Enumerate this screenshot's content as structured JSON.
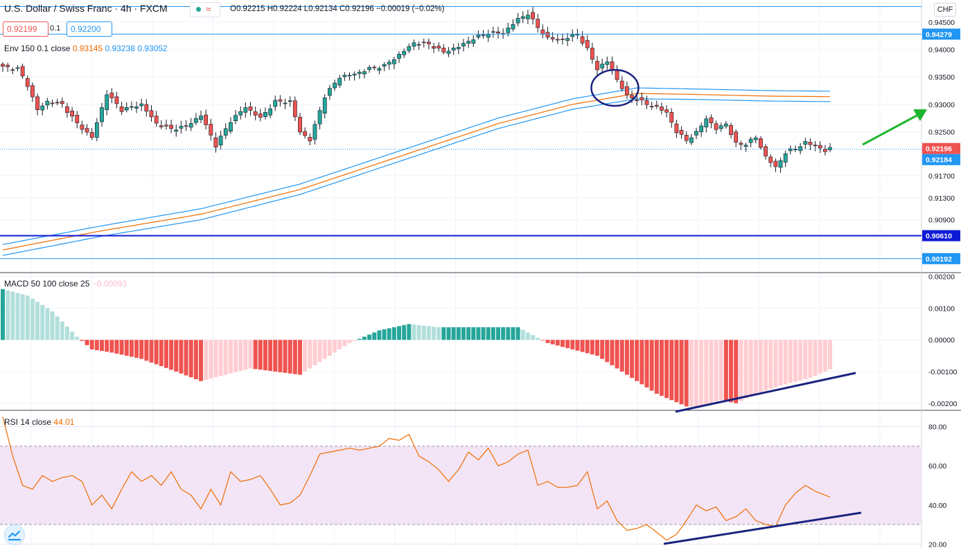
{
  "header": {
    "title": "U.S. Dollar / Swiss Franc · 4h · FXCM",
    "ohlc": "O0.92215  H0.92224  L0.92134  C0.92196  −0.00019 (−0.02%)",
    "bid": "0.92199",
    "spread": "0.1",
    "ask": "0.92200",
    "currency": "CHF"
  },
  "indicators": {
    "env_label": "Env 150 0.1 close",
    "env_v1": "0.93145",
    "env_v2": "0.93238",
    "env_v3": "0.93052",
    "macd_label": "MACD 50 100 close 25",
    "macd_value": "−0.00093",
    "rsi_label": "RSI 14 close",
    "rsi_value": "44.01"
  },
  "colors": {
    "up": "#26a69a",
    "down": "#ef5350",
    "env_mid": "#ef6c00",
    "env_band": "#2196f3",
    "rsi_line": "#ef6c00",
    "rsi_zone": "#f3e5f5",
    "hline_dark": "#0d1ad6",
    "hline_light": "#2196f3",
    "annotation": "#1a237e",
    "arrow": "#1cb52b",
    "macd_up_strong": "#26a69a",
    "macd_up_weak": "#b2dfdb",
    "macd_down_strong": "#ef5350",
    "macd_down_weak": "#ffcdd2"
  },
  "chart_data": [
    {
      "type": "candlestick",
      "panel": "price",
      "ylim": [
        0.8995,
        0.949
      ],
      "y_ticks": [
        "0.94500",
        "0.94000",
        "0.93500",
        "0.93000",
        "0.92500",
        "0.91700",
        "0.91300",
        "0.90900"
      ],
      "price_badges": [
        {
          "label": "0.94279",
          "price": 0.94279,
          "style": "light"
        },
        {
          "label": "0.92196",
          "price": 0.92196,
          "style": "current"
        },
        {
          "label": "0.92184",
          "price": 0.92184,
          "style": "light"
        },
        {
          "label": "0.90610",
          "price": 0.9061,
          "style": "dark"
        },
        {
          "label": "0.90192",
          "price": 0.90192,
          "style": "light"
        }
      ],
      "horizontal_lines": [
        {
          "price": 0.9478,
          "style": "light"
        },
        {
          "price": 0.94279,
          "style": "light"
        },
        {
          "price": 0.92184,
          "style": "dotted"
        },
        {
          "price": 0.9061,
          "style": "dark"
        },
        {
          "price": 0.90192,
          "style": "light"
        }
      ],
      "close_anchors": [
        [
          0,
          0.9368
        ],
        [
          3,
          0.9365
        ],
        [
          5,
          0.9335
        ],
        [
          7,
          0.929
        ],
        [
          9,
          0.9305
        ],
        [
          12,
          0.93
        ],
        [
          15,
          0.9265
        ],
        [
          18,
          0.924
        ],
        [
          21,
          0.932
        ],
        [
          24,
          0.929
        ],
        [
          28,
          0.93
        ],
        [
          31,
          0.9265
        ],
        [
          34,
          0.9255
        ],
        [
          37,
          0.926
        ],
        [
          40,
          0.928
        ],
        [
          43,
          0.9225
        ],
        [
          46,
          0.927
        ],
        [
          49,
          0.9295
        ],
        [
          52,
          0.9275
        ],
        [
          55,
          0.9305
        ],
        [
          58,
          0.9305
        ],
        [
          60,
          0.925
        ],
        [
          62,
          0.9235
        ],
        [
          65,
          0.9315
        ],
        [
          68,
          0.935
        ],
        [
          71,
          0.9355
        ],
        [
          74,
          0.9365
        ],
        [
          77,
          0.937
        ],
        [
          80,
          0.939
        ],
        [
          83,
          0.9412
        ],
        [
          86,
          0.941
        ],
        [
          89,
          0.9395
        ],
        [
          92,
          0.9405
        ],
        [
          95,
          0.942
        ],
        [
          98,
          0.943
        ],
        [
          101,
          0.943
        ],
        [
          104,
          0.9455
        ],
        [
          106,
          0.9465
        ],
        [
          108,
          0.944
        ],
        [
          110,
          0.942
        ],
        [
          113,
          0.9418
        ],
        [
          116,
          0.9428
        ],
        [
          118,
          0.94
        ],
        [
          120,
          0.9365
        ],
        [
          122,
          0.9378
        ],
        [
          124,
          0.9345
        ],
        [
          126,
          0.9315
        ],
        [
          128,
          0.931
        ],
        [
          130,
          0.93
        ],
        [
          132,
          0.9295
        ],
        [
          134,
          0.9285
        ],
        [
          136,
          0.925
        ],
        [
          138,
          0.9235
        ],
        [
          140,
          0.9248
        ],
        [
          142,
          0.9275
        ],
        [
          144,
          0.9255
        ],
        [
          146,
          0.9265
        ],
        [
          148,
          0.9228
        ],
        [
          150,
          0.9228
        ],
        [
          152,
          0.924
        ],
        [
          154,
          0.9205
        ],
        [
          156,
          0.9185
        ],
        [
          158,
          0.9212
        ],
        [
          160,
          0.922
        ],
        [
          162,
          0.923
        ],
        [
          164,
          0.9225
        ],
        [
          166,
          0.9215
        ],
        [
          167,
          0.92196
        ]
      ],
      "envelope": {
        "period": 150,
        "mid_points": [
          [
            0,
            0.9035
          ],
          [
            20,
            0.907
          ],
          [
            40,
            0.91
          ],
          [
            60,
            0.9145
          ],
          [
            80,
            0.9205
          ],
          [
            100,
            0.9265
          ],
          [
            115,
            0.93
          ],
          [
            128,
            0.932
          ],
          [
            140,
            0.9318
          ],
          [
            155,
            0.9315
          ],
          [
            167,
            0.9314
          ]
        ],
        "upper_points": [
          [
            0,
            0.9045
          ],
          [
            20,
            0.9079
          ],
          [
            40,
            0.911
          ],
          [
            60,
            0.9155
          ],
          [
            80,
            0.9215
          ],
          [
            100,
            0.9275
          ],
          [
            115,
            0.931
          ],
          [
            128,
            0.933
          ],
          [
            140,
            0.9328
          ],
          [
            155,
            0.9325
          ],
          [
            167,
            0.9324
          ]
        ],
        "lower_points": [
          [
            0,
            0.9025
          ],
          [
            20,
            0.906
          ],
          [
            40,
            0.909
          ],
          [
            60,
            0.9136
          ],
          [
            80,
            0.9196
          ],
          [
            100,
            0.9256
          ],
          [
            115,
            0.9291
          ],
          [
            128,
            0.931
          ],
          [
            140,
            0.9309
          ],
          [
            155,
            0.9306
          ],
          [
            167,
            0.9305
          ]
        ]
      }
    },
    {
      "type": "histogram",
      "panel": "macd",
      "ylim": [
        -0.0022,
        0.0021
      ],
      "y_ticks": [
        "0.00200",
        "0.00100",
        "0.00000",
        "-0.00100",
        "-0.00200"
      ],
      "anchors": [
        [
          0,
          0.0016
        ],
        [
          5,
          0.0014
        ],
        [
          10,
          0.0009
        ],
        [
          15,
          0.0001
        ],
        [
          18,
          -0.0003
        ],
        [
          22,
          -0.0004
        ],
        [
          28,
          -0.0006
        ],
        [
          35,
          -0.001
        ],
        [
          40,
          -0.0013
        ],
        [
          45,
          -0.0011
        ],
        [
          50,
          -0.0009
        ],
        [
          55,
          -0.001
        ],
        [
          60,
          -0.0011
        ],
        [
          65,
          -0.0006
        ],
        [
          70,
          -0.0001
        ],
        [
          76,
          0.0003
        ],
        [
          82,
          0.0005
        ],
        [
          88,
          0.0004
        ],
        [
          94,
          0.0004
        ],
        [
          100,
          0.0004
        ],
        [
          104,
          0.0004
        ],
        [
          110,
          -0.0001
        ],
        [
          115,
          -0.0003
        ],
        [
          120,
          -0.0005
        ],
        [
          126,
          -0.0011
        ],
        [
          132,
          -0.0017
        ],
        [
          138,
          -0.0021
        ],
        [
          141,
          -0.0021
        ],
        [
          145,
          -0.0019
        ],
        [
          148,
          -0.002
        ],
        [
          152,
          -0.0017
        ],
        [
          158,
          -0.0014
        ],
        [
          163,
          -0.0012
        ],
        [
          167,
          -0.00093
        ]
      ]
    },
    {
      "type": "line",
      "panel": "rsi",
      "ylim": [
        18,
        88
      ],
      "bands": [
        30,
        70
      ],
      "y_ticks": [
        "80.00",
        "60.00",
        "40.00",
        "20.00"
      ],
      "anchors": [
        [
          0,
          85
        ],
        [
          2,
          65
        ],
        [
          4,
          50
        ],
        [
          6,
          48
        ],
        [
          8,
          55
        ],
        [
          10,
          52
        ],
        [
          12,
          54
        ],
        [
          14,
          55
        ],
        [
          16,
          52
        ],
        [
          18,
          40
        ],
        [
          20,
          45
        ],
        [
          22,
          38
        ],
        [
          24,
          48
        ],
        [
          26,
          57
        ],
        [
          28,
          52
        ],
        [
          30,
          55
        ],
        [
          32,
          50
        ],
        [
          34,
          57
        ],
        [
          36,
          48
        ],
        [
          38,
          45
        ],
        [
          40,
          38
        ],
        [
          42,
          48
        ],
        [
          44,
          40
        ],
        [
          46,
          57
        ],
        [
          48,
          52
        ],
        [
          50,
          53
        ],
        [
          52,
          55
        ],
        [
          54,
          48
        ],
        [
          56,
          40
        ],
        [
          58,
          41
        ],
        [
          60,
          45
        ],
        [
          62,
          55
        ],
        [
          64,
          66
        ],
        [
          66,
          67
        ],
        [
          68,
          68
        ],
        [
          70,
          69
        ],
        [
          72,
          68
        ],
        [
          74,
          69
        ],
        [
          76,
          70
        ],
        [
          78,
          74
        ],
        [
          80,
          73
        ],
        [
          82,
          76
        ],
        [
          84,
          65
        ],
        [
          86,
          62
        ],
        [
          88,
          58
        ],
        [
          90,
          52
        ],
        [
          92,
          58
        ],
        [
          94,
          67
        ],
        [
          96,
          63
        ],
        [
          98,
          69
        ],
        [
          100,
          60
        ],
        [
          102,
          62
        ],
        [
          104,
          66
        ],
        [
          106,
          68
        ],
        [
          108,
          50
        ],
        [
          110,
          52
        ],
        [
          112,
          49
        ],
        [
          114,
          49
        ],
        [
          116,
          50
        ],
        [
          118,
          57
        ],
        [
          120,
          38
        ],
        [
          122,
          42
        ],
        [
          124,
          32
        ],
        [
          126,
          27
        ],
        [
          128,
          28
        ],
        [
          130,
          30
        ],
        [
          132,
          26
        ],
        [
          134,
          22
        ],
        [
          136,
          25
        ],
        [
          138,
          32
        ],
        [
          140,
          40
        ],
        [
          142,
          37
        ],
        [
          144,
          39
        ],
        [
          146,
          32
        ],
        [
          148,
          34
        ],
        [
          150,
          38
        ],
        [
          152,
          32
        ],
        [
          154,
          30
        ],
        [
          156,
          29
        ],
        [
          158,
          40
        ],
        [
          160,
          46
        ],
        [
          162,
          50
        ],
        [
          164,
          47
        ],
        [
          166,
          45
        ],
        [
          167,
          44.01
        ]
      ]
    }
  ]
}
